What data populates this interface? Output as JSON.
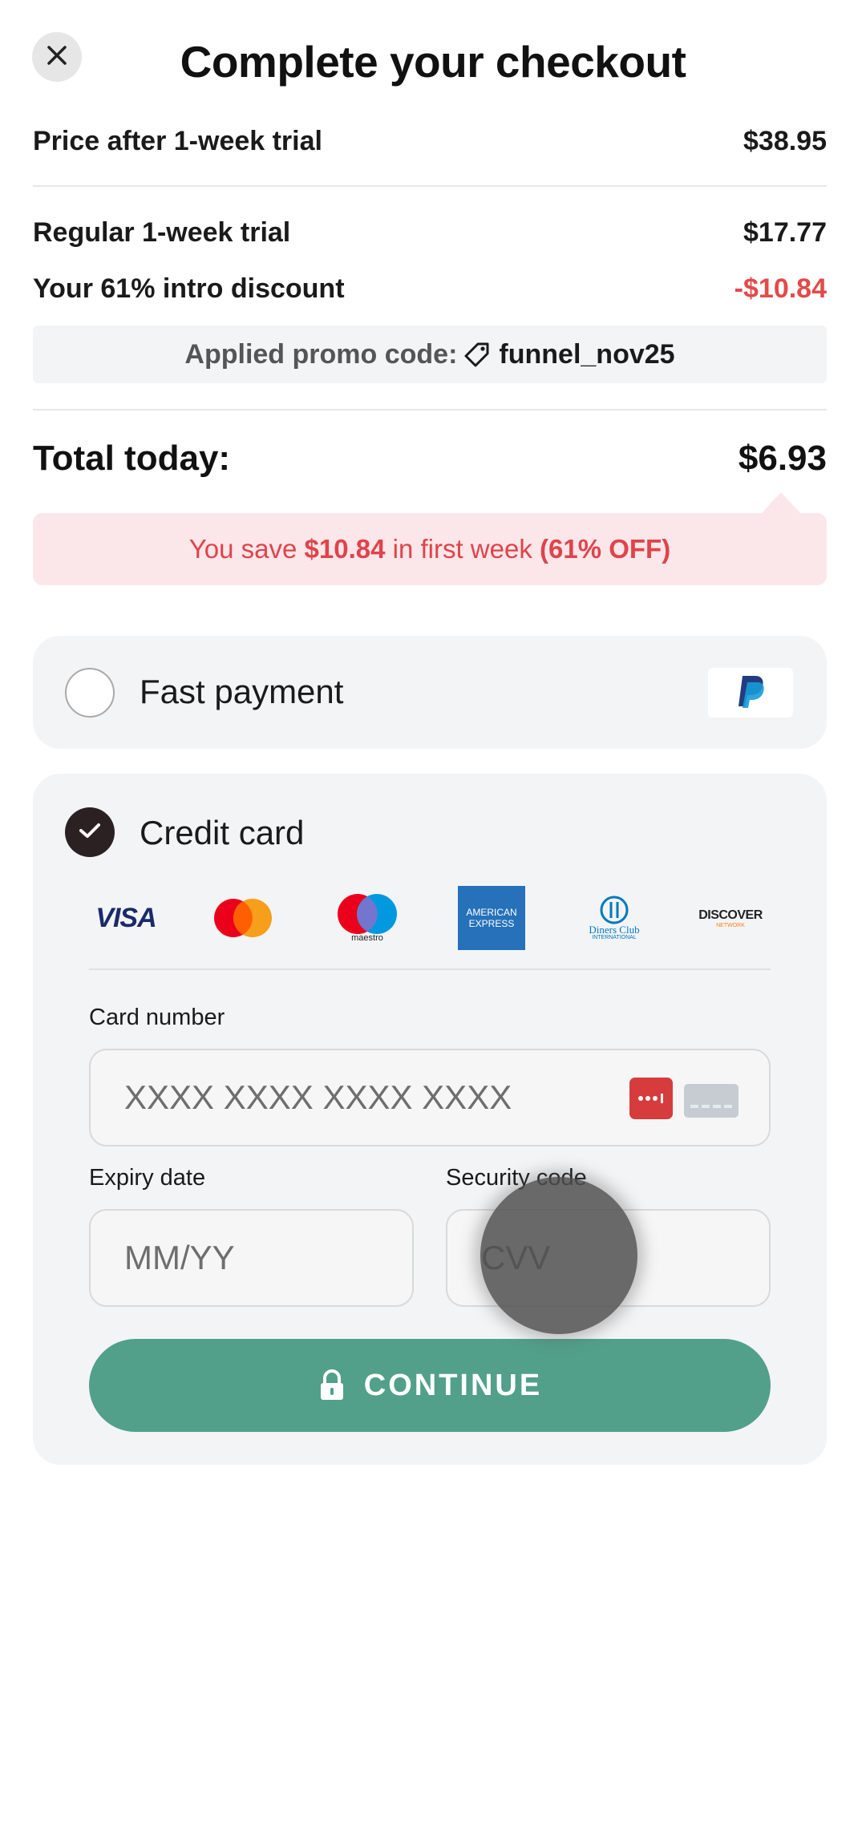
{
  "header": {
    "title": "Complete your checkout",
    "close_icon": "close-icon"
  },
  "summary": {
    "price_after_trial_label": "Price after 1-week trial",
    "price_after_trial_value": "$38.95",
    "regular_trial_label": "Regular 1-week trial",
    "regular_trial_value": "$17.77",
    "discount_label": "Your 61% intro discount",
    "discount_value": "-$10.84",
    "promo_label": "Applied promo code:",
    "promo_code": "funnel_nov25",
    "total_label": "Total today:",
    "total_value": "$6.93",
    "save_prefix": "You save",
    "save_amount": "$10.84",
    "save_middle": "in first week",
    "save_percent": "(61% OFF)"
  },
  "payment": {
    "fast_payment_label": "Fast payment",
    "fast_payment_selected": false,
    "credit_card_label": "Credit card",
    "credit_card_selected": true,
    "brands": [
      "VISA",
      "Mastercard",
      "Maestro",
      "American Express",
      "Diners Club",
      "Discover"
    ],
    "brand_text": {
      "visa": "VISA",
      "maestro": "maestro",
      "amex_1": "AMERICAN",
      "amex_2": "EXPRESS",
      "diners_1": "Diners Club",
      "diners_2": "INTERNATIONAL",
      "discover": "DISCOVER",
      "discover_sub": "NETWORK"
    }
  },
  "card_form": {
    "card_number_label": "Card number",
    "card_number_placeholder": "XXXX XXXX XXXX XXXX",
    "expiry_label": "Expiry date",
    "expiry_placeholder": "MM/YY",
    "security_label": "Security code",
    "security_placeholder": "CVV",
    "continue_label": "CONTINUE"
  },
  "colors": {
    "accent": "#52a089",
    "discount_red": "#e34a4a",
    "banner_bg": "#fbe7e9",
    "panel_bg": "#f3f4f6"
  }
}
